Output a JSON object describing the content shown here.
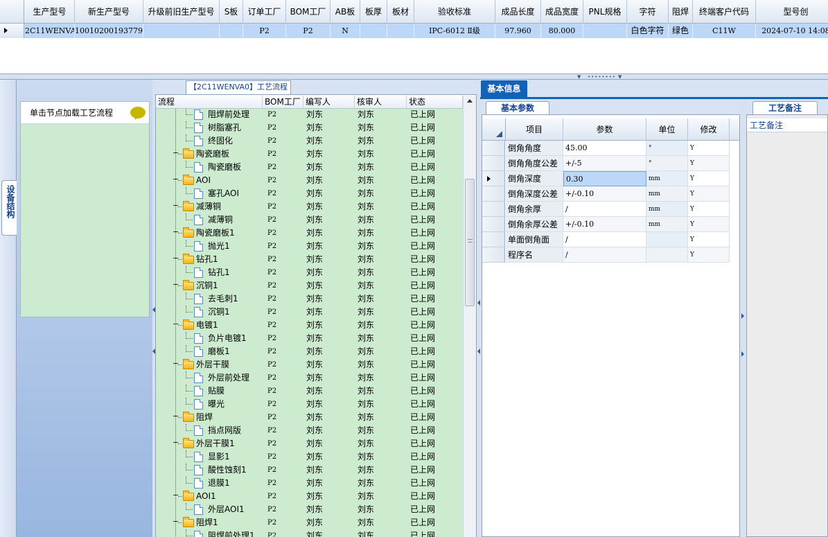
{
  "top_grid": {
    "columns": [
      "生产型号",
      "新生产型号",
      "升级前旧生产型号",
      "S板",
      "订单工厂",
      "BOM工厂",
      "AB板",
      "板厚",
      "板材",
      "验收标准",
      "成品长度",
      "成品宽度",
      "PNL规格",
      "字符",
      "阻焊",
      "终端客户代码",
      "型号创"
    ],
    "row": [
      "2C11WENVA0",
      "10010200193779",
      "",
      "",
      "P2",
      "P2",
      "N",
      "",
      "",
      "IPC-6012 Ⅱ级",
      "97.960",
      "80.000",
      "",
      "白色字符",
      "绿色",
      "C11W",
      "2024-07-10 14:08"
    ]
  },
  "left_panel": {
    "tab_label": "设备结构",
    "header_text": "单击节点加载工艺流程"
  },
  "tree_panel": {
    "title": "【2C11WENVA0】工艺流程",
    "columns": [
      "流程",
      "BOM工厂",
      "编写人",
      "核审人",
      "状态"
    ],
    "rows": [
      {
        "name": "阻焊前处理",
        "level": 2,
        "bom": "P2",
        "author": "刘东",
        "reviewer": "刘东",
        "status": "已上网"
      },
      {
        "name": "树脂塞孔",
        "level": 2,
        "bom": "P2",
        "author": "刘东",
        "reviewer": "刘东",
        "status": "已上网"
      },
      {
        "name": "终固化",
        "level": 2,
        "bom": "P2",
        "author": "刘东",
        "reviewer": "刘东",
        "status": "已上网"
      },
      {
        "name": "陶瓷磨板",
        "level": 1,
        "bom": "P2",
        "author": "刘东",
        "reviewer": "刘东",
        "status": "已上网"
      },
      {
        "name": "陶瓷磨板",
        "level": 2,
        "bom": "P2",
        "author": "刘东",
        "reviewer": "刘东",
        "status": "已上网"
      },
      {
        "name": "AOI",
        "level": 1,
        "bom": "P2",
        "author": "刘东",
        "reviewer": "刘东",
        "status": "已上网"
      },
      {
        "name": "塞孔AOI",
        "level": 2,
        "bom": "P2",
        "author": "刘东",
        "reviewer": "刘东",
        "status": "已上网"
      },
      {
        "name": "减薄铜",
        "level": 1,
        "bom": "P2",
        "author": "刘东",
        "reviewer": "刘东",
        "status": "已上网"
      },
      {
        "name": "减薄铜",
        "level": 2,
        "bom": "P2",
        "author": "刘东",
        "reviewer": "刘东",
        "status": "已上网"
      },
      {
        "name": "陶瓷磨板1",
        "level": 1,
        "bom": "P2",
        "author": "刘东",
        "reviewer": "刘东",
        "status": "已上网"
      },
      {
        "name": "抛光1",
        "level": 2,
        "bom": "P2",
        "author": "刘东",
        "reviewer": "刘东",
        "status": "已上网"
      },
      {
        "name": "钻孔1",
        "level": 1,
        "bom": "P2",
        "author": "刘东",
        "reviewer": "刘东",
        "status": "已上网"
      },
      {
        "name": "钻孔1",
        "level": 2,
        "bom": "P2",
        "author": "刘东",
        "reviewer": "刘东",
        "status": "已上网"
      },
      {
        "name": "沉铜1",
        "level": 1,
        "bom": "P2",
        "author": "刘东",
        "reviewer": "刘东",
        "status": "已上网"
      },
      {
        "name": "去毛刺1",
        "level": 2,
        "bom": "P2",
        "author": "刘东",
        "reviewer": "刘东",
        "status": "已上网"
      },
      {
        "name": "沉铜1",
        "level": 2,
        "bom": "P2",
        "author": "刘东",
        "reviewer": "刘东",
        "status": "已上网"
      },
      {
        "name": "电镀1",
        "level": 1,
        "bom": "P2",
        "author": "刘东",
        "reviewer": "刘东",
        "status": "已上网"
      },
      {
        "name": "负片电镀1",
        "level": 2,
        "bom": "P2",
        "author": "刘东",
        "reviewer": "刘东",
        "status": "已上网"
      },
      {
        "name": "磨板1",
        "level": 2,
        "bom": "P2",
        "author": "刘东",
        "reviewer": "刘东",
        "status": "已上网"
      },
      {
        "name": "外层干膜",
        "level": 1,
        "bom": "P2",
        "author": "刘东",
        "reviewer": "刘东",
        "status": "已上网"
      },
      {
        "name": "外层前处理",
        "level": 2,
        "bom": "P2",
        "author": "刘东",
        "reviewer": "刘东",
        "status": "已上网"
      },
      {
        "name": "贴膜",
        "level": 2,
        "bom": "P2",
        "author": "刘东",
        "reviewer": "刘东",
        "status": "已上网"
      },
      {
        "name": "曝光",
        "level": 2,
        "bom": "P2",
        "author": "刘东",
        "reviewer": "刘东",
        "status": "已上网"
      },
      {
        "name": "阻焊",
        "level": 1,
        "bom": "P2",
        "author": "刘东",
        "reviewer": "刘东",
        "status": "已上网"
      },
      {
        "name": "挡点网版",
        "level": 2,
        "bom": "P2",
        "author": "刘东",
        "reviewer": "刘东",
        "status": "已上网"
      },
      {
        "name": "外层干膜1",
        "level": 1,
        "bom": "P2",
        "author": "刘东",
        "reviewer": "刘东",
        "status": "已上网"
      },
      {
        "name": "显影1",
        "level": 2,
        "bom": "P2",
        "author": "刘东",
        "reviewer": "刘东",
        "status": "已上网"
      },
      {
        "name": "酸性蚀刻1",
        "level": 2,
        "bom": "P2",
        "author": "刘东",
        "reviewer": "刘东",
        "status": "已上网"
      },
      {
        "name": "退膜1",
        "level": 2,
        "bom": "P2",
        "author": "刘东",
        "reviewer": "刘东",
        "status": "已上网"
      },
      {
        "name": "AOI1",
        "level": 1,
        "bom": "P2",
        "author": "刘东",
        "reviewer": "刘东",
        "status": "已上网"
      },
      {
        "name": "外层AOI1",
        "level": 2,
        "bom": "P2",
        "author": "刘东",
        "reviewer": "刘东",
        "status": "已上网"
      },
      {
        "name": "阻焊1",
        "level": 1,
        "bom": "P2",
        "author": "刘东",
        "reviewer": "刘东",
        "status": "已上网"
      },
      {
        "name": "阻焊前处理1",
        "level": 2,
        "bom": "P2",
        "author": "刘东",
        "reviewer": "刘东",
        "status": "已上网"
      }
    ]
  },
  "info_panel": {
    "tab_label": "基本信息",
    "params_tab_label": "基本参数",
    "params_columns": [
      "项目",
      "参数",
      "单位",
      "修改"
    ],
    "params_rows": [
      {
        "item": "倒角角度",
        "value": "45.00",
        "unit": "°",
        "modify": "Y"
      },
      {
        "item": "倒角角度公差",
        "value": "+/-5",
        "unit": "°",
        "modify": "Y"
      },
      {
        "item": "倒角深度",
        "value": "0.30",
        "unit": "mm",
        "modify": "Y",
        "selected": true
      },
      {
        "item": "倒角深度公差",
        "value": "+/-0.10",
        "unit": "mm",
        "modify": "Y"
      },
      {
        "item": "倒角余厚",
        "value": "/",
        "unit": "mm",
        "modify": "Y"
      },
      {
        "item": "倒角余厚公差",
        "value": "+/-0.10",
        "unit": "mm",
        "modify": "Y"
      },
      {
        "item": "单面倒角面",
        "value": "/",
        "unit": "",
        "modify": "Y"
      },
      {
        "item": "程序名",
        "value": "/",
        "unit": "",
        "modify": "Y"
      }
    ],
    "notes_tab_label": "工艺备注",
    "notes_header": "工艺备注"
  },
  "colors": {
    "selected_row": "#bcd7f7",
    "tree_background": "#cdebcf",
    "accent": "#1462b5"
  }
}
